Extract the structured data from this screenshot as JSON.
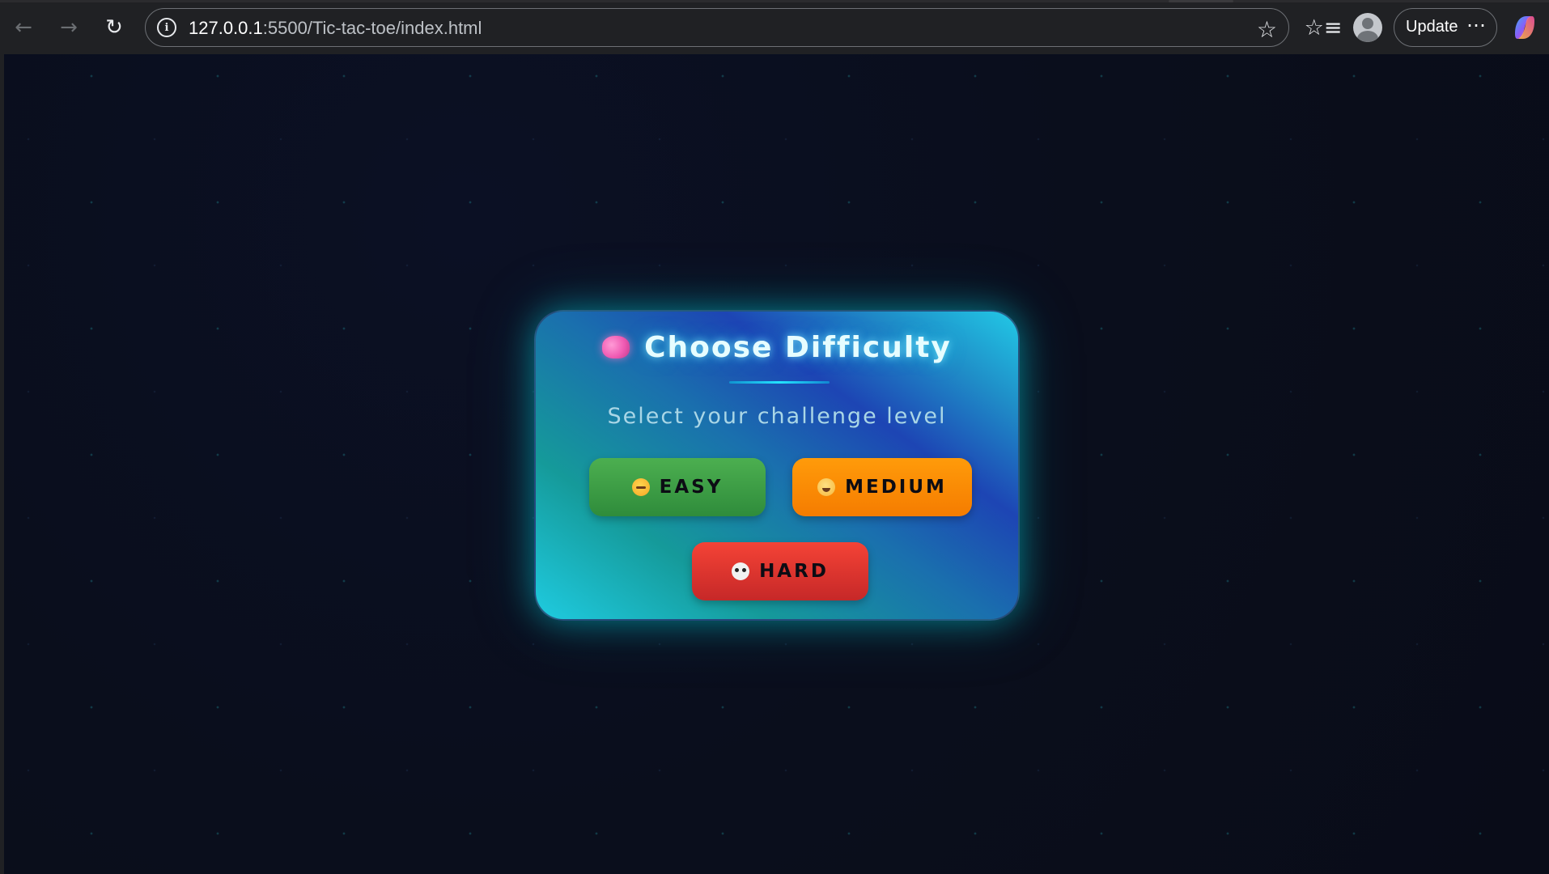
{
  "browser": {
    "back_icon": "arrow-left-icon",
    "forward_icon": "arrow-right-icon",
    "reload_icon": "reload-icon",
    "url_host": "127.0.0.1",
    "url_rest": ":5500/Tic-tac-toe/index.html",
    "update_label": "Update",
    "menu_label": "⋯"
  },
  "card": {
    "title": "Choose Difficulty",
    "subtitle": "Select your challenge level",
    "buttons": {
      "easy": "EASY",
      "medium": "MEDIUM",
      "hard": "HARD"
    }
  },
  "colors": {
    "easy": "#43a047",
    "medium": "#fb8c00",
    "hard": "#e53935",
    "accent": "#22d3ee",
    "background": "#0a0e1c"
  }
}
